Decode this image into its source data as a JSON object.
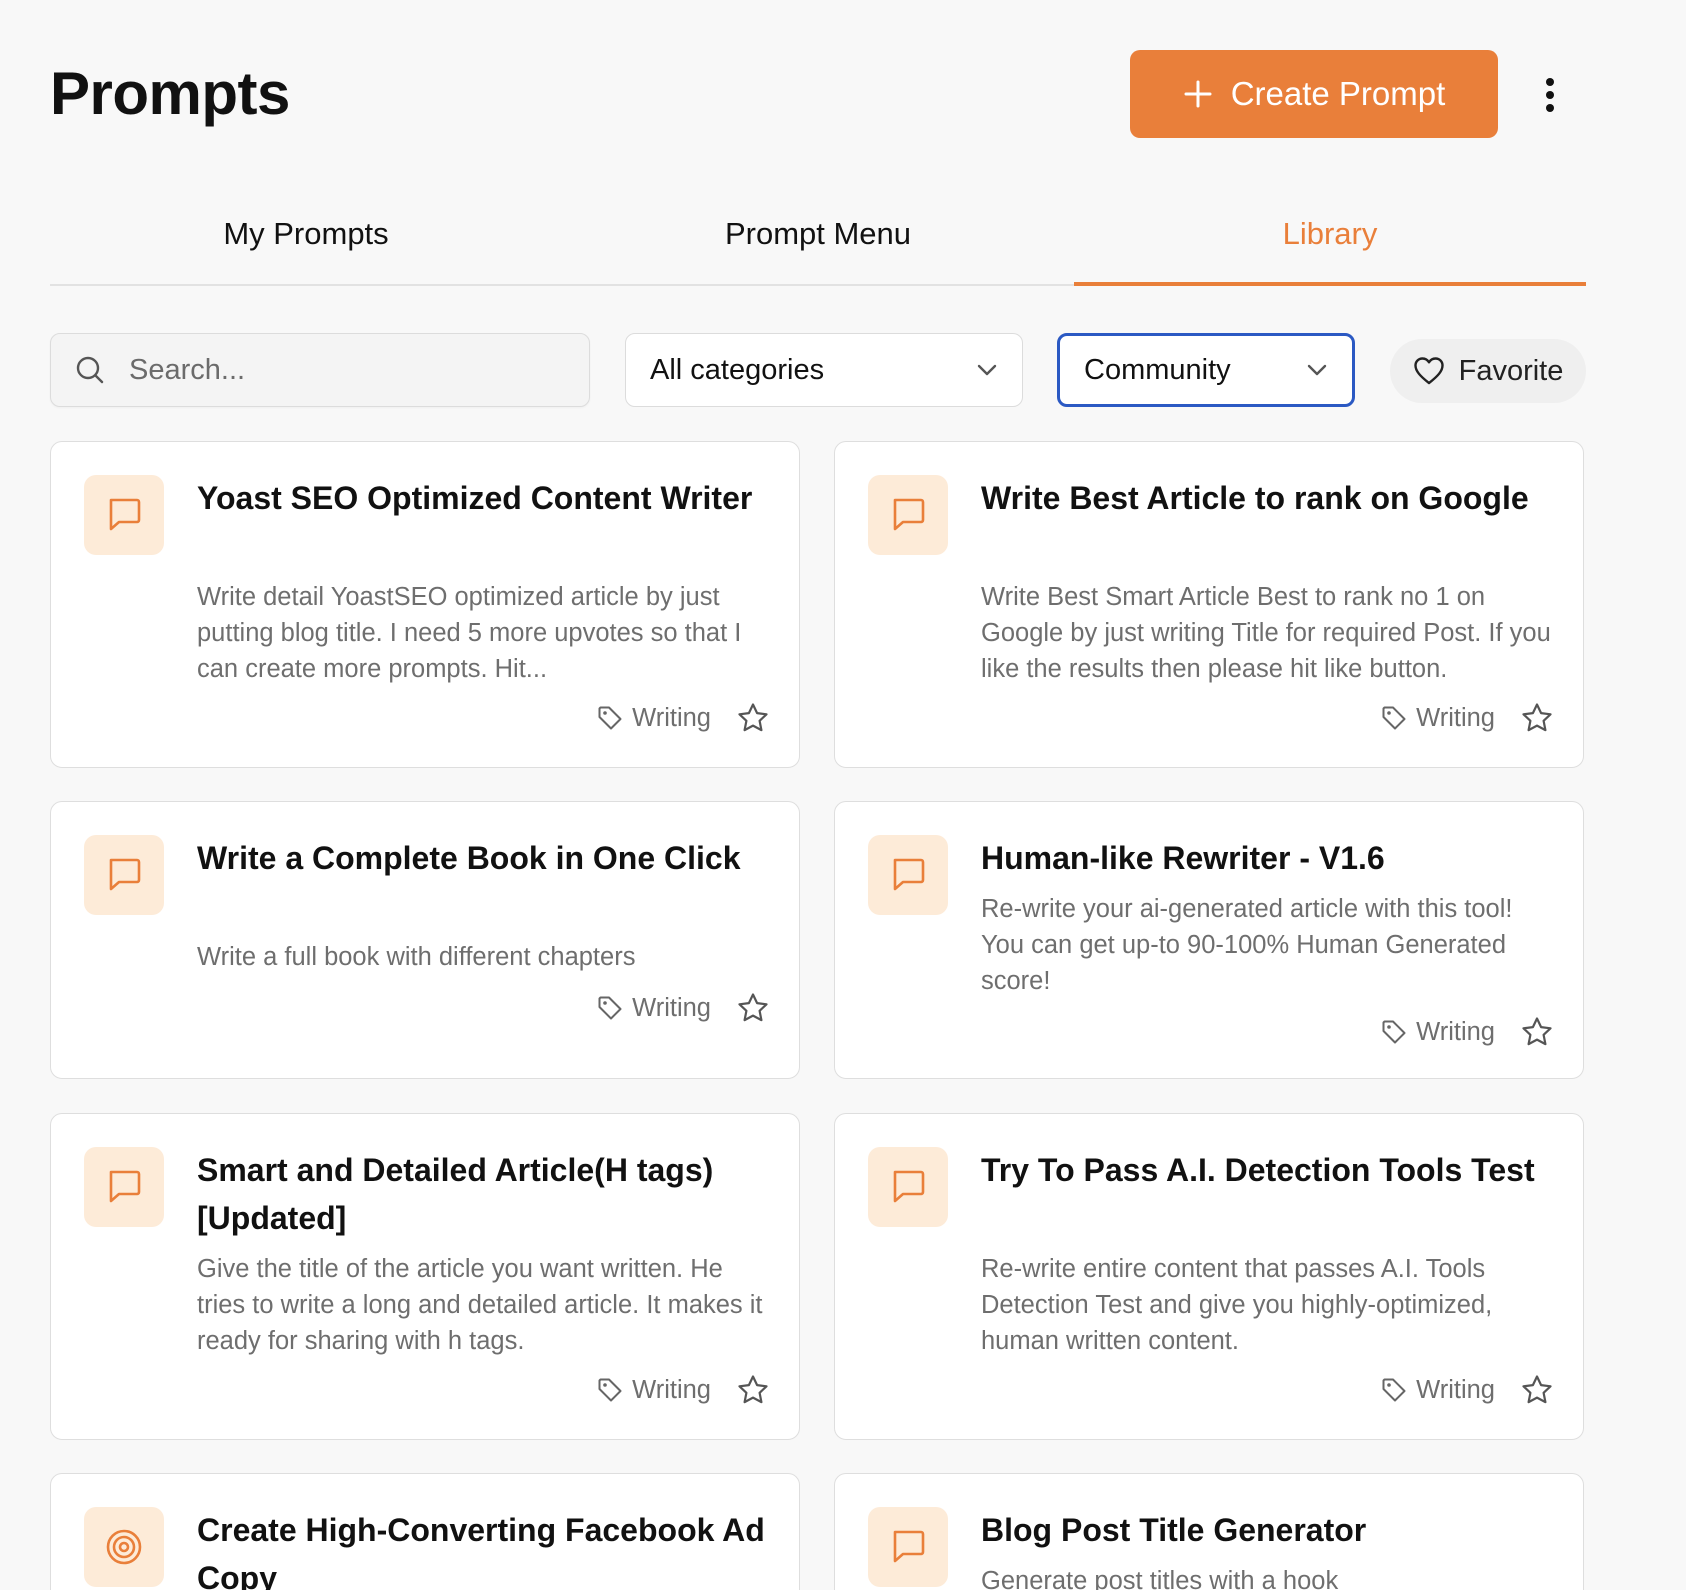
{
  "header": {
    "title": "Prompts",
    "create_label": "Create Prompt"
  },
  "tabs": [
    {
      "label": "My Prompts",
      "active": false
    },
    {
      "label": "Prompt Menu",
      "active": false
    },
    {
      "label": "Library",
      "active": true
    }
  ],
  "filters": {
    "search_placeholder": "Search...",
    "category_value": "All categories",
    "source_value": "Community",
    "favorite_label": "Favorite"
  },
  "colors": {
    "accent": "#e97f3a",
    "icon_bg": "#fdebd8",
    "focus_border": "#2b59c3"
  },
  "cards": [
    {
      "title": "Yoast SEO Optimized Content Writer",
      "description": "Write detail YoastSEO optimized article by just putting blog title. I need 5 more upvotes so that I can create more prompts. Hit...",
      "tag": "Writing",
      "icon": "chat-bubble-icon"
    },
    {
      "title": "Write Best Article to rank on Google",
      "description": "Write Best Smart Article Best to rank no 1 on Google by just writing Title for required Post. If you like the results then please hit like button.",
      "tag": "Writing",
      "icon": "chat-bubble-icon"
    },
    {
      "title": "Write a Complete Book in One Click",
      "description": "Write a full book with different chapters",
      "tag": "Writing",
      "icon": "chat-bubble-icon"
    },
    {
      "title": "Human-like Rewriter - V1.6",
      "description": "Re-write your ai-generated article with this tool! You can get up-to 90-100% Human Generated score!",
      "tag": "Writing",
      "icon": "chat-bubble-icon"
    },
    {
      "title": "Smart and Detailed Article(H tags) [Updated]",
      "description": "Give the title of the article you want written. He tries to write a long and detailed article. It makes it ready for sharing with h tags.",
      "tag": "Writing",
      "icon": "chat-bubble-icon"
    },
    {
      "title": "Try To Pass A.I. Detection Tools Test",
      "description": "Re-write entire content that passes A.I. Tools Detection Test and give you highly-optimized, human written content.",
      "tag": "Writing",
      "icon": "chat-bubble-icon"
    },
    {
      "title": "Create High-Converting Facebook Ad Copy",
      "description": "",
      "tag": "",
      "icon": "target-icon"
    },
    {
      "title": "Blog Post Title Generator",
      "description": "Generate post titles with a hook",
      "tag": "",
      "icon": "chat-bubble-icon"
    }
  ]
}
